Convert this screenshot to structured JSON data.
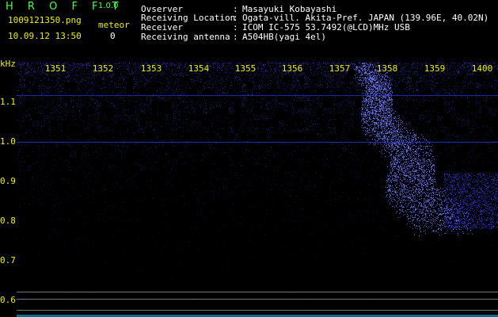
{
  "header": {
    "app_title": "H R O F F T",
    "app_version": "1.0.0",
    "filename": "1009121350.png",
    "datetime": "10.09.12 13:50",
    "meteor_label": "meteor",
    "meteor_count": "0"
  },
  "station": {
    "observer_label": "Ovserver",
    "observer_value": "Masayuki Kobayashi",
    "location_label": "Receiving Location",
    "location_value": "Ogata-vill. Akita-Pref. JAPAN (139.96E, 40.02N)",
    "receiver_label": "Receiver",
    "receiver_value": "ICOM IC-575 53.7492(@LCD)MHz USB",
    "antenna_label": "Receiving antenna",
    "antenna_value": "A504HB(yagi 4el)",
    "separator": ":"
  },
  "axes": {
    "y_unit": "kHz",
    "x_ticks": [
      "1351",
      "1352",
      "1353",
      "1354",
      "1355",
      "1356",
      "1357",
      "1358",
      "1359",
      "1400"
    ],
    "y_ticks": [
      "1.1",
      "1.0",
      "0.9",
      "0.8",
      "0.7",
      "0.6"
    ]
  },
  "colors": {
    "background": "#000000",
    "label_yellow": "#f0f000",
    "title_green": "#4cff4c",
    "noise_blue": "#2a3aff",
    "signal_blue": "#6a7cff",
    "baseline_cyan": "#00c8ff"
  }
}
